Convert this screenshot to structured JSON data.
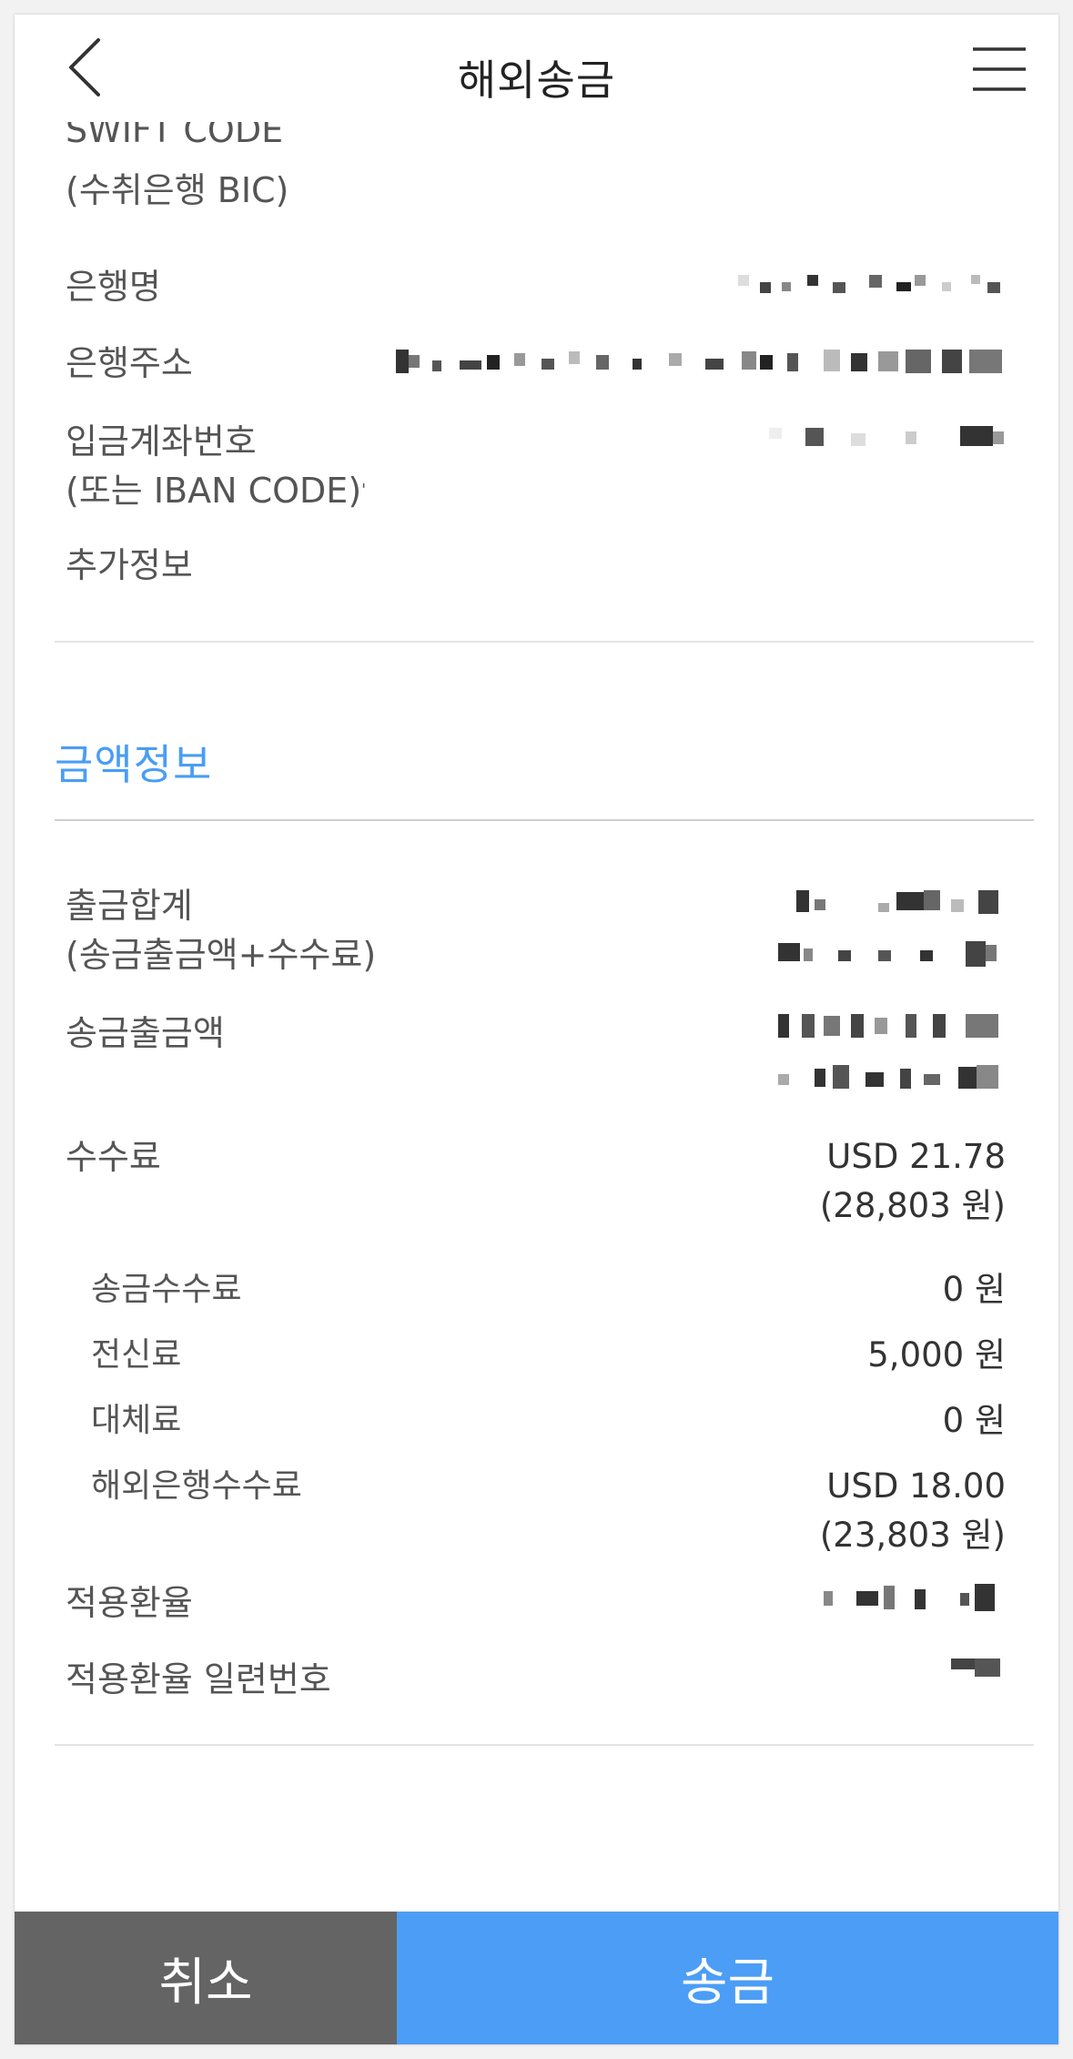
{
  "header": {
    "title": "해외송금",
    "back_icon": "chevron-left-icon",
    "menu_icon": "hamburger-menu-icon"
  },
  "beneficiary_bank": {
    "swift_label_line1": "SWIFT CODE",
    "swift_label_line2": "(수취은행 BIC)",
    "bank_name_label": "은행명",
    "bank_address_label": "은행주소",
    "account_label_line1": "입금계좌번호",
    "account_label_line2": "(또는 IBAN CODE)",
    "extra_info_label": "추가정보"
  },
  "amount_section": {
    "title": "금액정보",
    "total_label_line1": "출금합계",
    "total_label_line2": "(송금출금액+수수료)",
    "remit_amount_label": "송금출금액",
    "fee_label": "수수료",
    "fee_value_line1": "USD 21.78",
    "fee_value_line2": "(28,803 원)",
    "fee_items": [
      {
        "label": "송금수수료",
        "value_line1": "0 원",
        "value_line2": ""
      },
      {
        "label": "전신료",
        "value_line1": "5,000 원",
        "value_line2": ""
      },
      {
        "label": "대체료",
        "value_line1": "0 원",
        "value_line2": ""
      },
      {
        "label": "해외은행수수료",
        "value_line1": "USD 18.00",
        "value_line2": "(23,803 원)"
      }
    ],
    "rate_label": "적용환율",
    "rate_serial_label": "적용환율 일련번호"
  },
  "footer": {
    "cancel_label": "취소",
    "send_label": "송금"
  },
  "colors": {
    "accent_blue": "#4c9df5",
    "cancel_gray": "#646464",
    "section_title_blue": "#4a9df5"
  }
}
